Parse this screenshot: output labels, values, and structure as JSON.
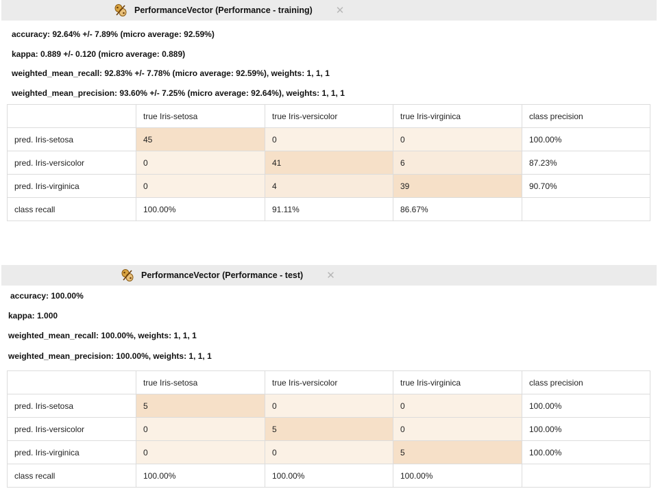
{
  "training": {
    "tab_title": "PerformanceVector (Performance - training)",
    "close_glyph": "✕",
    "metrics": {
      "accuracy": "accuracy: 92.64% +/- 7.89% (micro average: 92.59%)",
      "kappa": "kappa: 0.889 +/- 0.120 (micro average: 0.889)",
      "recall": "weighted_mean_recall: 92.83% +/- 7.78% (micro average: 92.59%), weights: 1, 1, 1",
      "precision": "weighted_mean_precision: 93.60% +/- 7.25% (micro average: 92.64%), weights: 1, 1, 1"
    },
    "table": {
      "headers": [
        "",
        "true Iris-setosa",
        "true Iris-versicolor",
        "true Iris-virginica",
        "class precision"
      ],
      "rows": [
        [
          "pred. Iris-setosa",
          "45",
          "0",
          "0",
          "100.00%"
        ],
        [
          "pred. Iris-versicolor",
          "0",
          "41",
          "6",
          "87.23%"
        ],
        [
          "pred. Iris-virginica",
          "0",
          "4",
          "39",
          "90.70%"
        ],
        [
          "class recall",
          "100.00%",
          "91.11%",
          "86.67%",
          ""
        ]
      ]
    }
  },
  "test": {
    "tab_title": "PerformanceVector (Performance - test)",
    "close_glyph": "✕",
    "metrics": {
      "accuracy": "accuracy: 100.00%",
      "kappa": "kappa: 1.000",
      "recall": "weighted_mean_recall: 100.00%, weights: 1, 1, 1",
      "precision": "weighted_mean_precision: 100.00%, weights: 1, 1, 1"
    },
    "table": {
      "headers": [
        "",
        "true Iris-setosa",
        "true Iris-versicolor",
        "true Iris-virginica",
        "class precision"
      ],
      "rows": [
        [
          "pred. Iris-setosa",
          "5",
          "0",
          "0",
          "100.00%"
        ],
        [
          "pred. Iris-versicolor",
          "0",
          "5",
          "0",
          "100.00%"
        ],
        [
          "pred. Iris-virginica",
          "0",
          "0",
          "5",
          "100.00%"
        ],
        [
          "class recall",
          "100.00%",
          "100.00%",
          "100.00%",
          ""
        ]
      ]
    }
  },
  "colors": {
    "tab_bar": "#ebebeb",
    "cell_low": "#fbf1e5",
    "cell_mid": "#f9ebdc",
    "cell_high": "#f6e0c8"
  },
  "icons": {
    "tab_icon": "performance-vector-icon",
    "close": "close-icon"
  }
}
